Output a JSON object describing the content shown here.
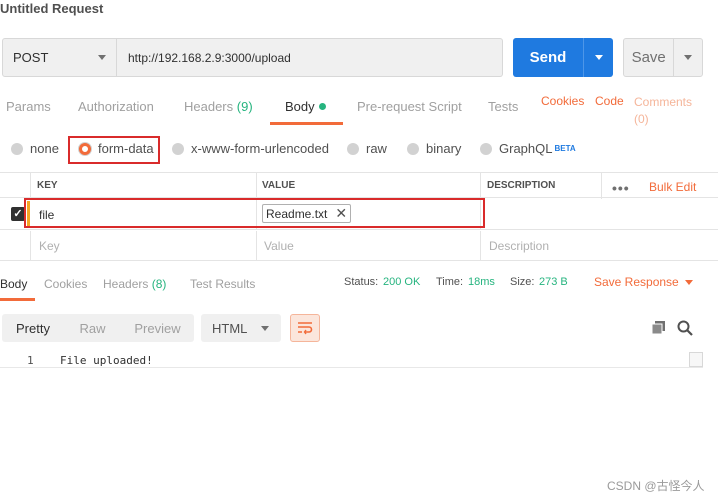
{
  "title": "Untitled Request",
  "request": {
    "method": "POST",
    "url": "http://192.168.2.9:3000/upload",
    "send_label": "Send",
    "save_label": "Save"
  },
  "req_tabs": [
    {
      "label": "Params"
    },
    {
      "label": "Authorization"
    },
    {
      "label": "Headers",
      "count": "(9)"
    },
    {
      "label": "Body",
      "active": true
    },
    {
      "label": "Pre-request Script"
    },
    {
      "label": "Tests"
    }
  ],
  "side_links": {
    "cookies": "Cookies",
    "code": "Code",
    "comments": "Comments",
    "comments_count": "(0)"
  },
  "body_options": [
    {
      "label": "none"
    },
    {
      "label": "form-data",
      "selected": true
    },
    {
      "label": "x-www-form-urlencoded"
    },
    {
      "label": "raw"
    },
    {
      "label": "binary"
    },
    {
      "label": "GraphQL",
      "badge": "BETA"
    }
  ],
  "kv_table": {
    "headers": {
      "key": "KEY",
      "value": "VALUE",
      "description": "DESCRIPTION"
    },
    "more": "•••",
    "bulk_edit": "Bulk Edit",
    "rows": [
      {
        "checked": true,
        "key": "file",
        "file": "Readme.txt"
      }
    ],
    "placeholders": {
      "key": "Key",
      "value": "Value",
      "description": "Description"
    }
  },
  "response": {
    "tabs": [
      {
        "label": "Body",
        "active": true
      },
      {
        "label": "Cookies"
      },
      {
        "label": "Headers",
        "count": "(8)"
      },
      {
        "label": "Test Results"
      }
    ],
    "status_label": "Status:",
    "status_value": "200 OK",
    "time_label": "Time:",
    "time_value": "18ms",
    "size_label": "Size:",
    "size_value": "273 B",
    "save_response": "Save Response",
    "view_modes": [
      "Pretty",
      "Raw",
      "Preview"
    ],
    "language": "HTML",
    "lines": [
      {
        "num": "1",
        "text": "File uploaded!"
      }
    ]
  },
  "watermark": "CSDN @古怪今人",
  "colors": {
    "accent": "#f26b3a",
    "send": "#1f7ae0",
    "success": "#26b47f",
    "highlight_box": "#d92b2b"
  }
}
